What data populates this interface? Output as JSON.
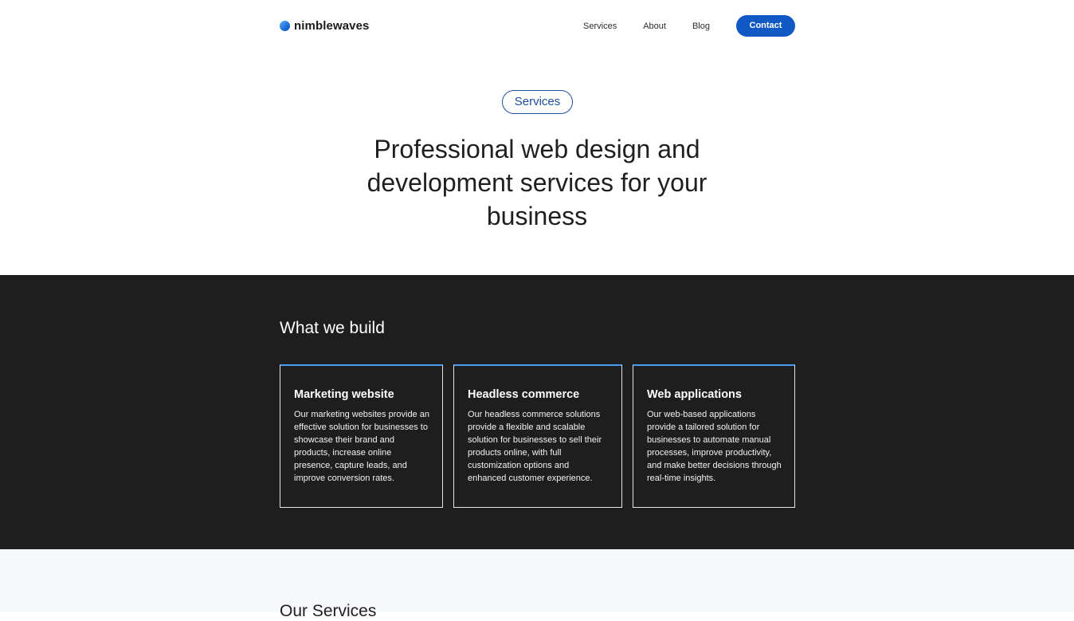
{
  "brand": {
    "name": "nimblewaves",
    "logo_icon": "gradient-circle",
    "accent_color": "#1059c4"
  },
  "nav": {
    "services": "Services",
    "about": "About",
    "blog": "Blog",
    "contact": "Contact"
  },
  "hero": {
    "badge": "Services",
    "title": "Professional web design and development services for your business"
  },
  "build": {
    "title": "What we build",
    "cards": [
      {
        "title": "Marketing website",
        "text": "Our marketing websites provide an effective solution for businesses to showcase their brand and products, increase online presence, capture leads, and improve conversion rates."
      },
      {
        "title": "Headless commerce",
        "text": "Our headless commerce solutions provide a flexible and scalable solution for businesses to sell their products online, with full customization options and enhanced customer experience."
      },
      {
        "title": "Web applications",
        "text": "Our web-based applications provide a tailored solution for businesses to automate manual processes, improve productivity, and make better decisions through real-time insights."
      }
    ]
  },
  "our_services": {
    "title": "Our Services"
  }
}
